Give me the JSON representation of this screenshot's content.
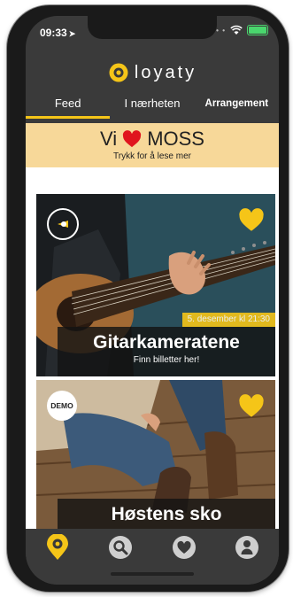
{
  "status_bar": {
    "time": "09:33"
  },
  "app": {
    "title": "loyaty"
  },
  "tabs": [
    {
      "label": "Feed"
    },
    {
      "label": "I nærheten"
    },
    {
      "label": "Arrangement"
    }
  ],
  "banner": {
    "title_left": "Vi",
    "title_right": "MOSS",
    "subtitle": "Trykk for å lese mer"
  },
  "cards": [
    {
      "badge": "",
      "date": "5. desember kl 21:30",
      "title": "Gitarkameratene",
      "subtitle": "Finn billetter her!"
    },
    {
      "badge": "DEMO",
      "title": "Høstens sko"
    }
  ],
  "colors": {
    "accent": "#f5c518",
    "banner": "#f7d899",
    "heart_red": "#e0141e",
    "bar": "#3a3a3a"
  },
  "bottom_nav": [
    {
      "icon": "location-pin-icon",
      "active": true
    },
    {
      "icon": "search-icon",
      "active": false
    },
    {
      "icon": "heart-icon",
      "active": false
    },
    {
      "icon": "profile-icon",
      "active": false
    }
  ]
}
